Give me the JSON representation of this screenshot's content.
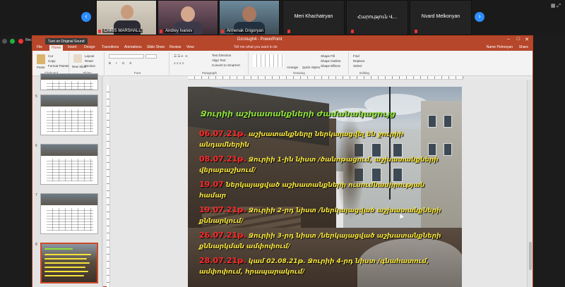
{
  "zoom": {
    "participants": [
      {
        "name": "CHRIS MARSHALL",
        "type": "video"
      },
      {
        "name": "Andrey Ivanov",
        "type": "video"
      },
      {
        "name": "Armenak Grigoryan",
        "type": "video"
      },
      {
        "name": "Meri Khachatryan",
        "type": "audio"
      },
      {
        "name": "Հարություն Վ...",
        "type": "audio"
      },
      {
        "name": "Nvard Melkonyan",
        "type": "audio"
      }
    ],
    "recording_label": "Recording",
    "turn_on_sound": "Turn on Original Sound"
  },
  "ppt": {
    "window_title": "Dzrstugh4 - PowerPoint",
    "tabs": [
      "File",
      "Home",
      "Insert",
      "Design",
      "Transitions",
      "Animations",
      "Slide Show",
      "Review",
      "View"
    ],
    "active_tab": "Home",
    "tell_me": "Tell me what you want to do",
    "user": "Name Petrosyan",
    "share": "Share",
    "ribbon": {
      "clipboard": {
        "label": "Clipboard",
        "paste": "Paste",
        "cut": "Cut",
        "copy": "Copy",
        "format_painter": "Format Painter"
      },
      "slides": {
        "label": "Slides",
        "new_slide": "New Slide",
        "layout": "Layout",
        "reset": "Reset",
        "section": "Section"
      },
      "font": {
        "label": "Font"
      },
      "paragraph": {
        "label": "Paragraph",
        "text_direction": "Text Direction",
        "align_text": "Align Text",
        "convert_smartart": "Convert to SmartArt"
      },
      "drawing": {
        "label": "Drawing",
        "arrange": "Arrange",
        "quick_styles": "Quick Styles",
        "shape_fill": "Shape Fill",
        "shape_outline": "Shape Outline",
        "shape_effects": "Shape Effects"
      },
      "editing": {
        "label": "Editing",
        "find": "Find",
        "replace": "Replace",
        "select": "Select"
      }
    },
    "thumb_numbers": [
      "5",
      "6",
      "7",
      "8"
    ]
  },
  "slide": {
    "title": "Ջուրիի աշխատանքների ժամանակացույց",
    "entries": [
      {
        "date": "06.07.21թ.",
        "text": " աշխատանքները ներկայացվել են ջուրիի անդամներին"
      },
      {
        "date": "08.07.21թ.",
        "text": " Ջուրիի 1-ին նիստ /ծանոթացում, աշխատանքների վերաբաշխում/"
      },
      {
        "date": "19.07",
        "text": " ներկայացված աշխատանքների ուսումնասիրության համար"
      },
      {
        "date": "19.07.21թ.",
        "text": " Ջուրիի 2-րդ նիստ /ներկայացված աշխատանքների քննարկում/"
      },
      {
        "date": "26.07.21թ.",
        "text": " Ջուրիի 3-րդ նիստ /ներկայացված աշխատանքների քննարկման ամփոփում/"
      },
      {
        "date": "28.07.21թ.",
        "text": " կամ 02.08.21թ. Ջուրիի 4-րդ նիստ /գնահատում, ամփոփում, հրապարակում/"
      }
    ]
  },
  "colors": {
    "ppt_accent": "#b7472a",
    "zoom_blue": "#2d8cff",
    "title_green": "#8fe03a",
    "text_yellow": "#f4e23a",
    "date_red": "#ff2a2a"
  }
}
